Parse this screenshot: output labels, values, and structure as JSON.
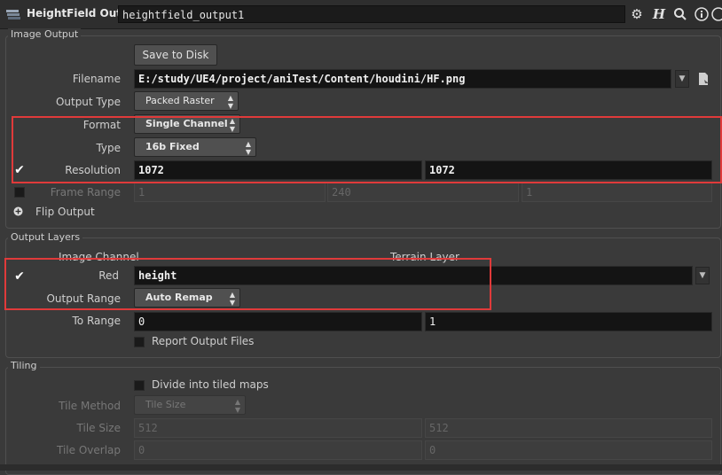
{
  "header": {
    "node_type": "HeightField Output",
    "node_name": "heightfield_output1",
    "icons": [
      "gear-icon",
      "help-h-icon",
      "search-icon",
      "info-icon",
      "question-icon"
    ]
  },
  "image_output": {
    "section_title": "Image Output",
    "save_button": "Save to Disk",
    "filename_label": "Filename",
    "filename_value": "E:/study/UE4/project/aniTest/Content/houdini/HF.png",
    "output_type_label": "Output Type",
    "output_type_value": "Packed Raster",
    "format_label": "Format",
    "format_value": "Single Channel",
    "type_label": "Type",
    "type_value": "16b Fixed",
    "resolution_label": "Resolution",
    "resolution_x": "1072",
    "resolution_y": "1072",
    "frame_range_label": "Frame Range",
    "frame_start": "1",
    "frame_end": "240",
    "frame_inc": "1",
    "flip_output_label": "Flip Output"
  },
  "output_layers": {
    "section_title": "Output Layers",
    "col_image_channel": "Image Channel",
    "col_terrain_layer": "Terrain Layer",
    "red_label": "Red",
    "red_value": "height",
    "output_range_label": "Output Range",
    "output_range_value": "Auto Remap",
    "to_range_label": "To Range",
    "to_range_min": "0",
    "to_range_max": "1",
    "report_label": "Report Output Files"
  },
  "tiling": {
    "section_title": "Tiling",
    "divide_label": "Divide into tiled maps",
    "tile_method_label": "Tile Method",
    "tile_method_value": "Tile Size",
    "tile_size_label": "Tile Size",
    "tile_size_x": "512",
    "tile_size_y": "512",
    "tile_overlap_label": "Tile Overlap",
    "tile_overlap_x": "0",
    "tile_overlap_y": "0"
  },
  "colors": {
    "background": "#3a3a3a",
    "field_bg": "#141414",
    "highlight_box": "#e03a3a"
  }
}
